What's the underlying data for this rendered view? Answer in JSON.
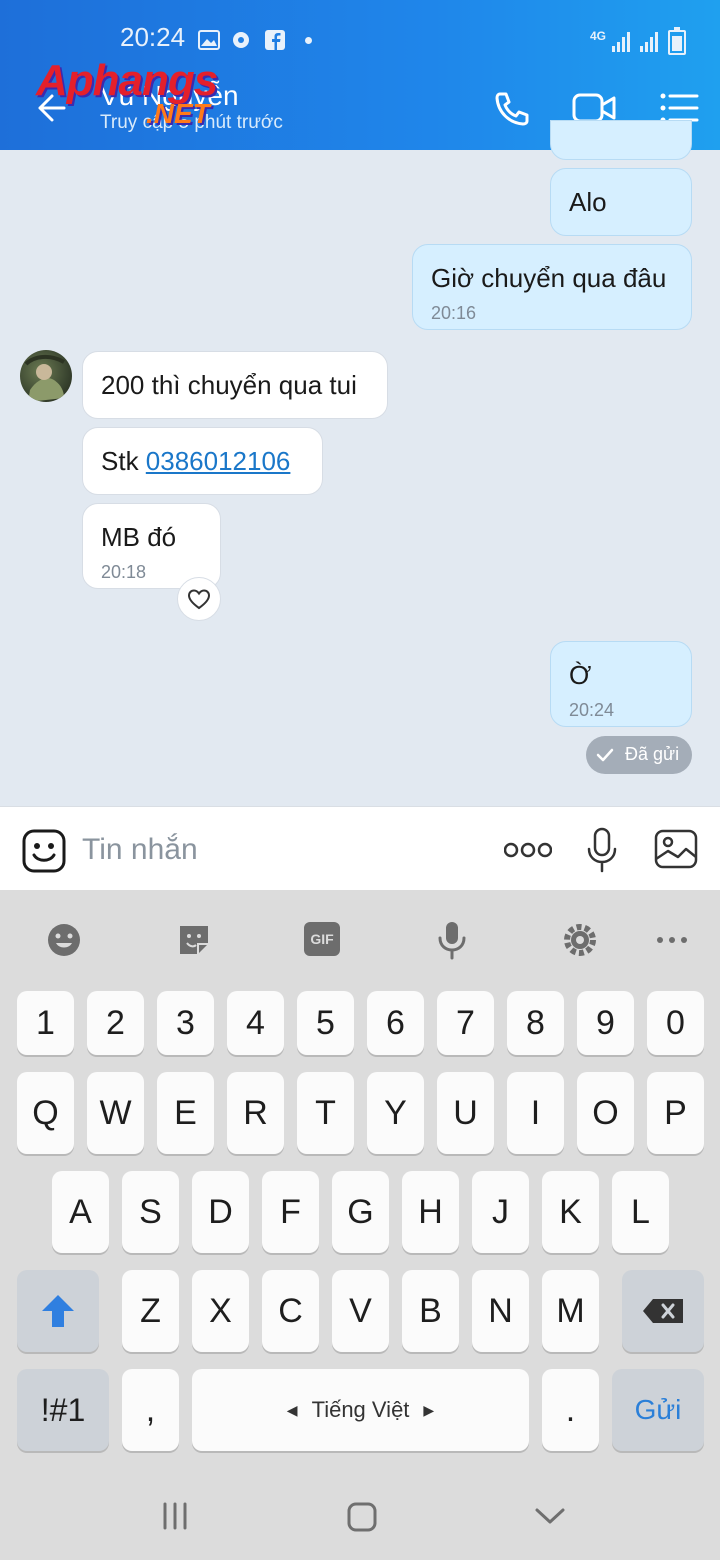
{
  "status_bar": {
    "time": "20:24",
    "network": "4G"
  },
  "header": {
    "contact_name": "Vũ Nguyễn",
    "last_seen": "Truy cập 5 phút trước",
    "watermark_top": "Aphangs",
    "watermark_bottom": ".NET"
  },
  "messages": {
    "m1": {
      "text": "Alo"
    },
    "m2": {
      "text": "Giờ chuyển qua đâu",
      "time": "20:16"
    },
    "m3": {
      "text": "200 thì chuyển qua tui"
    },
    "m4": {
      "prefix": "Stk ",
      "link": "0386012106"
    },
    "m5": {
      "text": "MB đó",
      "time": "20:18"
    },
    "m6": {
      "text": "Ờ",
      "time": "20:24"
    },
    "sent_status": "Đã gửi"
  },
  "composer": {
    "placeholder": "Tin nhắn"
  },
  "keyboard": {
    "numbers": [
      "1",
      "2",
      "3",
      "4",
      "5",
      "6",
      "7",
      "8",
      "9",
      "0"
    ],
    "row1": [
      "Q",
      "W",
      "E",
      "R",
      "T",
      "Y",
      "U",
      "I",
      "O",
      "P"
    ],
    "row2": [
      "A",
      "S",
      "D",
      "F",
      "G",
      "H",
      "J",
      "K",
      "L"
    ],
    "row3": [
      "Z",
      "X",
      "C",
      "V",
      "B",
      "N",
      "M"
    ],
    "symbols_key": "!#1",
    "comma_key": ",",
    "space_key": "Tiếng Việt",
    "period_key": ".",
    "send_key": "Gửi",
    "toolbar_gif": "GIF"
  },
  "colors": {
    "header_start": "#1e6fd9",
    "header_end": "#1fa0ef",
    "outgoing_bubble": "#d6efff",
    "link": "#1a77c9",
    "send_key": "#2a7fd8"
  }
}
